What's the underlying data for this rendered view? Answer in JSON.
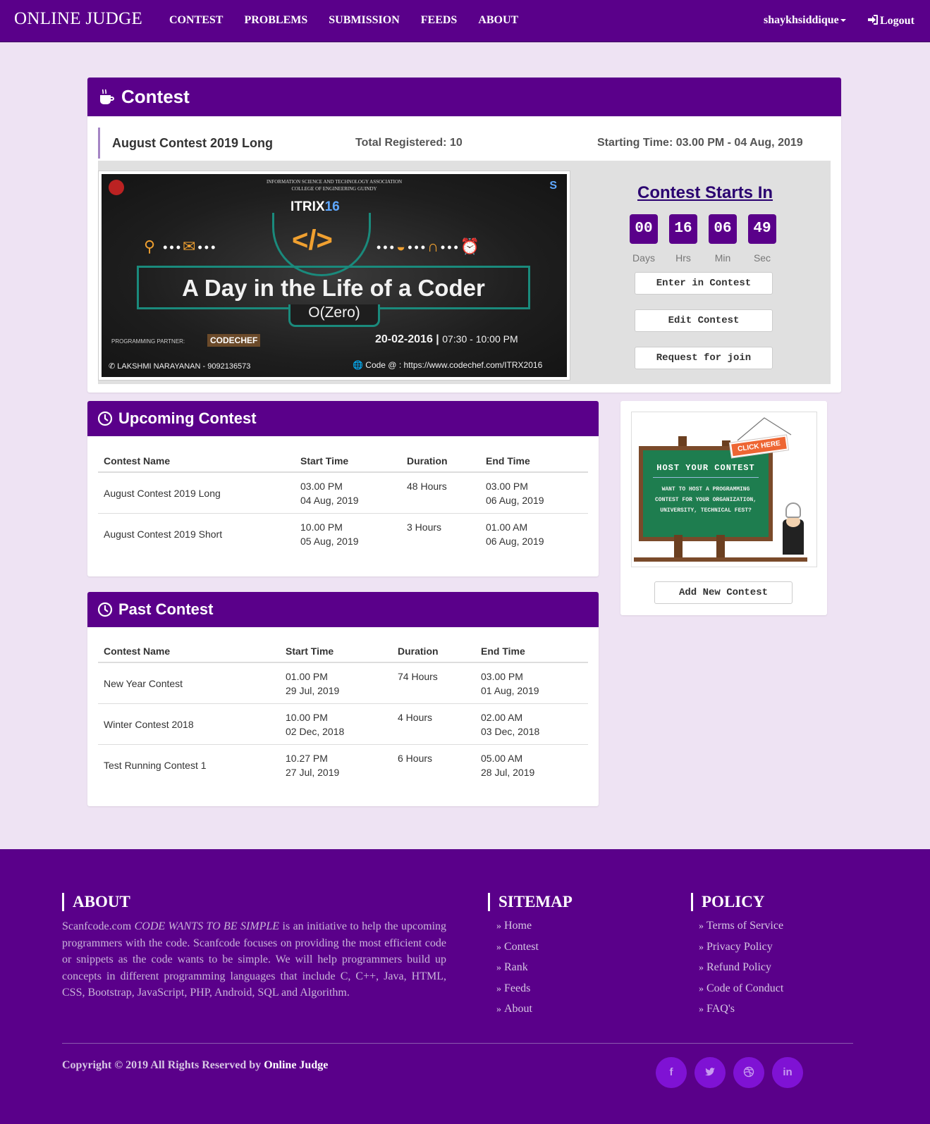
{
  "nav": {
    "brand": "ONLINE JUDGE",
    "links": [
      "CONTEST",
      "PROBLEMS",
      "SUBMISSION",
      "FEEDS",
      "ABOUT"
    ],
    "user": "shaykhsiddique",
    "logout": "Logout"
  },
  "contest": {
    "heading": "Contest",
    "name": "August Contest 2019 Long",
    "total_registered": "Total Registered: 10",
    "starting_time": "Starting Time: 03.00 PM - 04 Aug, 2019",
    "countdown_title": "Contest Starts In",
    "countdown": [
      {
        "value": "00",
        "label": "Days"
      },
      {
        "value": "16",
        "label": "Hrs"
      },
      {
        "value": "06",
        "label": "Min"
      },
      {
        "value": "49",
        "label": "Sec"
      }
    ],
    "buttons": {
      "enter": "Enter in Contest",
      "edit": "Edit Contest",
      "request": "Request for join"
    },
    "banner": {
      "org_line1": "INFORMATION SCIENCE AND TECHNOLOGY ASSOCIATION",
      "org_line2": "COLLEGE OF ENGINEERING GUINDY",
      "event": "ITRIX",
      "event_year": "16",
      "title": "A Day in the Life of a Coder",
      "subtitle": "O(Zero)",
      "partner_label": "PROGRAMMING PARTNER:",
      "partner": "CODECHEF",
      "date": "20-02-2016",
      "time": "07:30 - 10:00 PM",
      "contact": "LAKSHMI NARAYANAN - 9092136573",
      "url": "Code @ : https://www.codechef.com/ITRX2016"
    }
  },
  "upcoming": {
    "heading": "Upcoming Contest",
    "columns": [
      "Contest Name",
      "Start Time",
      "Duration",
      "End Time"
    ],
    "rows": [
      {
        "name": "August Contest 2019 Long",
        "start_time": "03.00 PM",
        "start_date": "04 Aug, 2019",
        "duration": "48 Hours",
        "end_time": "03.00 PM",
        "end_date": "06 Aug, 2019"
      },
      {
        "name": "August Contest 2019 Short",
        "start_time": "10.00 PM",
        "start_date": "05 Aug, 2019",
        "duration": "3 Hours",
        "end_time": "01.00 AM",
        "end_date": "06 Aug, 2019"
      }
    ]
  },
  "past": {
    "heading": "Past Contest",
    "columns": [
      "Contest Name",
      "Start Time",
      "Duration",
      "End Time"
    ],
    "rows": [
      {
        "name": "New Year Contest",
        "start_time": "01.00 PM",
        "start_date": "29 Jul, 2019",
        "duration": "74 Hours",
        "end_time": "03.00 PM",
        "end_date": "01 Aug, 2019"
      },
      {
        "name": "Winter Contest 2018",
        "start_time": "10.00 PM",
        "start_date": "02 Dec, 2018",
        "duration": "4 Hours",
        "end_time": "02.00 AM",
        "end_date": "03 Dec, 2018"
      },
      {
        "name": "Test Running Contest 1",
        "start_time": "10.27 PM",
        "start_date": "27 Jul, 2019",
        "duration": "6 Hours",
        "end_time": "05.00 AM",
        "end_date": "28 Jul, 2019"
      }
    ]
  },
  "host": {
    "click_here": "CLICK HERE",
    "board_title": "HOST YOUR CONTEST",
    "board_text": "WANT TO HOST A PROGRAMMING CONTEST FOR YOUR ORGANIZATION, UNIVERSITY, TECHNICAL FEST?",
    "add_button": "Add New Contest"
  },
  "footer": {
    "about_heading": "ABOUT",
    "about_site": "Scanfcode.com",
    "about_tagline": "CODE WANTS TO BE SIMPLE",
    "about_text": "is an initiative to help the upcoming programmers with the code. Scanfcode focuses on providing the most efficient code or snippets as the code wants to be simple. We will help programmers build up concepts in different programming languages that include C, C++, Java, HTML, CSS, Bootstrap, JavaScript, PHP, Android, SQL and Algorithm.",
    "sitemap_heading": "SITEMAP",
    "sitemap": [
      "Home",
      "Contest",
      "Rank",
      "Feeds",
      "About"
    ],
    "policy_heading": "POLICY",
    "policy": [
      "Terms of Service",
      "Privacy Policy",
      "Refund Policy",
      "Code of Conduct",
      "FAQ's"
    ],
    "copyright": "Copyright © 2019 All Rights Reserved by",
    "copyright_owner": "Online Judge",
    "social": [
      "f",
      "t",
      "d",
      "in"
    ]
  },
  "colors": {
    "primary": "#5a008a",
    "page_bg": "#eee3f3",
    "social_bg": "#7f12d4"
  }
}
